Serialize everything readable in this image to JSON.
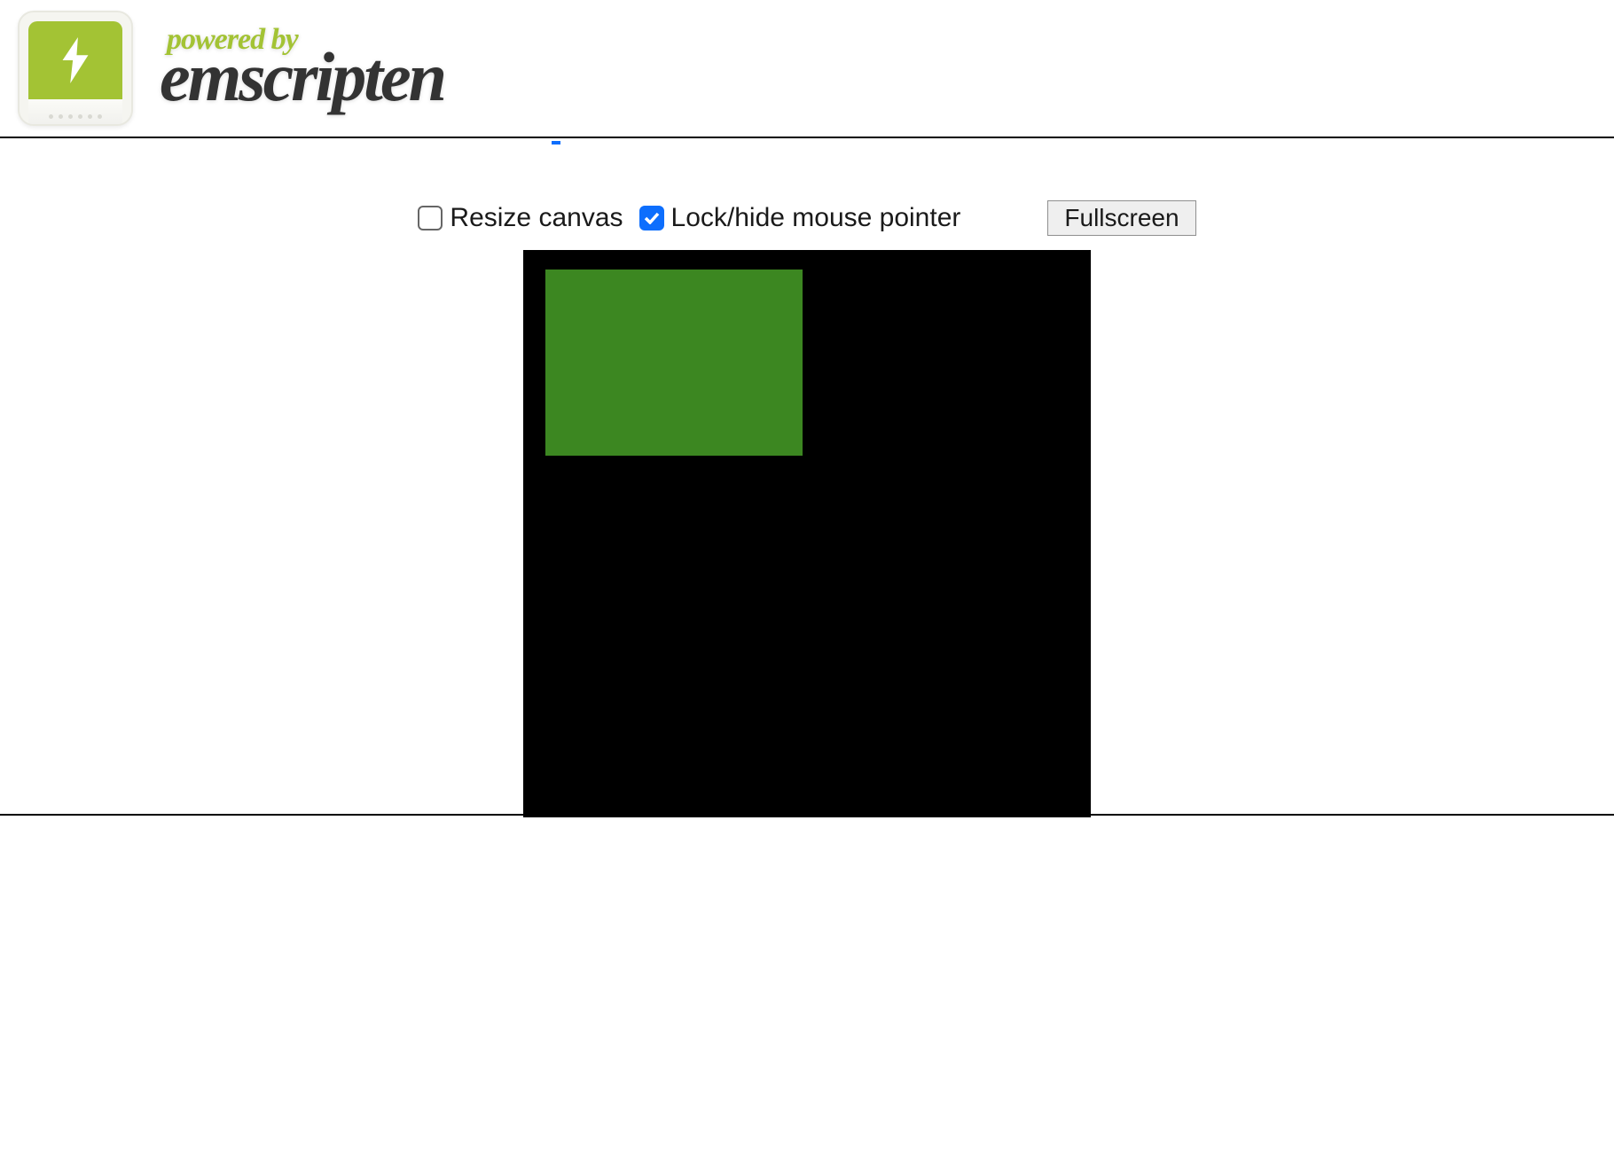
{
  "header": {
    "subtitle": "powered by",
    "title": "emscripten"
  },
  "controls": {
    "resize_label": "Resize canvas",
    "resize_checked": false,
    "lock_label": "Lock/hide mouse pointer",
    "lock_checked": true,
    "fullscreen_label": "Fullscreen"
  },
  "canvas": {
    "bg_color": "#000000",
    "shape_color": "#3c8721"
  }
}
